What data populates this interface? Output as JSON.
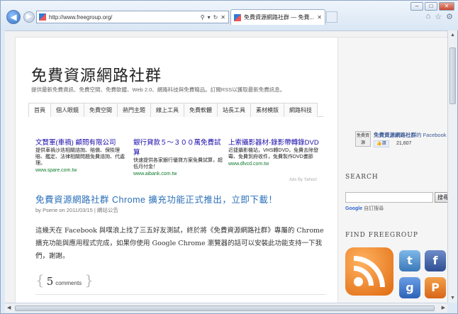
{
  "browser": {
    "address": "http://www.freegroup.org/",
    "tab_title": "免費資源網路社群 — 免費..."
  },
  "site": {
    "title": "免費資源網路社群",
    "tagline": "提供最新免費資訊、免費空間、免費軟體、Web 2.0、網路科技與免費贈品。訂閱RSS以獲取最新免費訊息。"
  },
  "menu": [
    {
      "label": "首頁"
    },
    {
      "label": "個人眼鏡"
    },
    {
      "label": "免費空間"
    },
    {
      "label": "熱門主題"
    },
    {
      "label": "線上工具"
    },
    {
      "label": "免費軟體"
    },
    {
      "label": "站長工具"
    },
    {
      "label": "素材模版"
    },
    {
      "label": "網路科技"
    }
  ],
  "ads": [
    {
      "title": "文賢軍(車禍) 顧問有限公司",
      "desc": "提供車禍沙迭相關諮詢、賠償、保險理賠、鑑定、法律相關問題免費諮詢、代處理。",
      "url": "www.spare.com.tw"
    },
    {
      "title": "銀行貸款５～３００萬免費試算",
      "desc": "快速提供各家銀行優貸方案免費試算，超低月付金！",
      "url": "www.aibank.com.tw"
    },
    {
      "title": "上索攝影器材-錄影帶轉錄DVD",
      "desc": "近捷攝影機站，VHS轉DVD，免費去除發霉、免費到府收件，免費製作DVD畫節",
      "url": "www.dlvcd.com.tw"
    }
  ],
  "ads_label": "Ads By Yahoo!",
  "post": {
    "title": "免費資源網路社群 Chrome 擴充功能正式推出，立即下載！",
    "meta": "by Pserie on 2011/03/15 | 網站公告",
    "body": "這幾天在 Facebook 與噗浪上找了三五好友測試，終於將《免費資源網路社群》專屬的 Chrome 擴充功能與應用程式完成，如果你使用 Google Chrome 瀏覽器的話可以安裝此功能支持一下我們，謝謝。",
    "comment_count": "5",
    "comment_label": "comments"
  },
  "sidebar": {
    "fb_logo": "免費資源",
    "fb_name": "免費資源網路社群",
    "fb_suffix": "的 Facebook",
    "fb_like": "讚",
    "fb_count": "21,607",
    "search_heading": "SEARCH",
    "search_button": "搜尋",
    "google_brand": "Google",
    "google_label": "自訂搜尋",
    "find_heading": "FIND FREEGROUP"
  }
}
